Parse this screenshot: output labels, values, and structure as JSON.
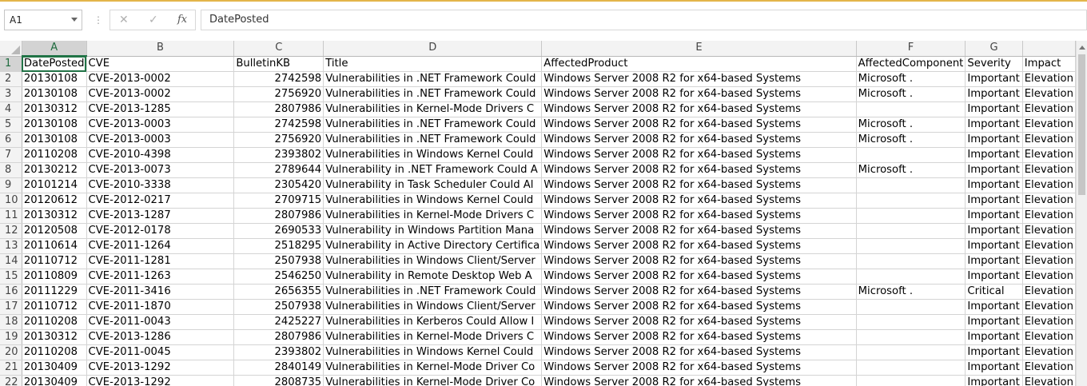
{
  "formula_bar": {
    "name_box": "A1",
    "separator": "⋮",
    "cancel_icon": "✕",
    "enter_icon": "✓",
    "fx_label": "fx",
    "content": "DatePosted"
  },
  "columns": [
    "A",
    "B",
    "C",
    "D",
    "E",
    "F",
    "G",
    ""
  ],
  "rows": [
    {
      "n": "1",
      "c": [
        "DatePosted",
        "CVE",
        "BulletinKB",
        "Title",
        "AffectedProduct",
        "AffectedComponent",
        "Severity",
        "Impact"
      ]
    },
    {
      "n": "2",
      "c": [
        "20130108",
        "CVE-2013-0002",
        "2742598",
        "Vulnerabilities in .NET Framework Could",
        "Windows Server 2008 R2 for x64-based Systems",
        "Microsoft .",
        "Important",
        "Elevation"
      ]
    },
    {
      "n": "3",
      "c": [
        "20130108",
        "CVE-2013-0002",
        "2756920",
        "Vulnerabilities in .NET Framework Could",
        "Windows Server 2008 R2 for x64-based Systems",
        "Microsoft .",
        "Important",
        "Elevation"
      ]
    },
    {
      "n": "4",
      "c": [
        "20130312",
        "CVE-2013-1285",
        "2807986",
        "Vulnerabilities in Kernel-Mode Drivers C",
        "Windows Server 2008 R2 for x64-based Systems",
        "",
        "Important",
        "Elevation"
      ]
    },
    {
      "n": "5",
      "c": [
        "20130108",
        "CVE-2013-0003",
        "2742598",
        "Vulnerabilities in .NET Framework Could",
        "Windows Server 2008 R2 for x64-based Systems",
        "Microsoft .",
        "Important",
        "Elevation"
      ]
    },
    {
      "n": "6",
      "c": [
        "20130108",
        "CVE-2013-0003",
        "2756920",
        "Vulnerabilities in .NET Framework Could",
        "Windows Server 2008 R2 for x64-based Systems",
        "Microsoft .",
        "Important",
        "Elevation"
      ]
    },
    {
      "n": "7",
      "c": [
        "20110208",
        "CVE-2010-4398",
        "2393802",
        "Vulnerabilities in Windows Kernel Could",
        "Windows Server 2008 R2 for x64-based Systems",
        "",
        "Important",
        "Elevation"
      ]
    },
    {
      "n": "8",
      "c": [
        "20130212",
        "CVE-2013-0073",
        "2789644",
        "Vulnerability in .NET Framework Could A",
        "Windows Server 2008 R2 for x64-based Systems",
        "Microsoft .",
        "Important",
        "Elevation"
      ]
    },
    {
      "n": "9",
      "c": [
        "20101214",
        "CVE-2010-3338",
        "2305420",
        "Vulnerability in Task Scheduler Could Al",
        "Windows Server 2008 R2 for x64-based Systems",
        "",
        "Important",
        "Elevation"
      ]
    },
    {
      "n": "10",
      "c": [
        "20120612",
        "CVE-2012-0217",
        "2709715",
        "Vulnerabilities in Windows Kernel Could",
        "Windows Server 2008 R2 for x64-based Systems",
        "",
        "Important",
        "Elevation"
      ]
    },
    {
      "n": "11",
      "c": [
        "20130312",
        "CVE-2013-1287",
        "2807986",
        "Vulnerabilities in Kernel-Mode Drivers C",
        "Windows Server 2008 R2 for x64-based Systems",
        "",
        "Important",
        "Elevation"
      ]
    },
    {
      "n": "12",
      "c": [
        "20120508",
        "CVE-2012-0178",
        "2690533",
        "Vulnerability in Windows Partition Mana",
        "Windows Server 2008 R2 for x64-based Systems",
        "",
        "Important",
        "Elevation"
      ]
    },
    {
      "n": "13",
      "c": [
        "20110614",
        "CVE-2011-1264",
        "2518295",
        "Vulnerability in Active Directory Certifica",
        "Windows Server 2008 R2 for x64-based Systems",
        "",
        "Important",
        "Elevation"
      ]
    },
    {
      "n": "14",
      "c": [
        "20110712",
        "CVE-2011-1281",
        "2507938",
        "Vulnerabilities in Windows Client/Server",
        "Windows Server 2008 R2 for x64-based Systems",
        "",
        "Important",
        "Elevation"
      ]
    },
    {
      "n": "15",
      "c": [
        "20110809",
        "CVE-2011-1263",
        "2546250",
        "Vulnerability in Remote Desktop Web A",
        "Windows Server 2008 R2 for x64-based Systems",
        "",
        "Important",
        "Elevation"
      ]
    },
    {
      "n": "16",
      "c": [
        "20111229",
        "CVE-2011-3416",
        "2656355",
        "Vulnerabilities in .NET Framework Could",
        "Windows Server 2008 R2 for x64-based Systems",
        "Microsoft .",
        "Critical",
        "Elevation"
      ]
    },
    {
      "n": "17",
      "c": [
        "20110712",
        "CVE-2011-1870",
        "2507938",
        "Vulnerabilities in Windows Client/Server",
        "Windows Server 2008 R2 for x64-based Systems",
        "",
        "Important",
        "Elevation"
      ]
    },
    {
      "n": "18",
      "c": [
        "20110208",
        "CVE-2011-0043",
        "2425227",
        "Vulnerabilities in Kerberos Could Allow I",
        "Windows Server 2008 R2 for x64-based Systems",
        "",
        "Important",
        "Elevation"
      ]
    },
    {
      "n": "19",
      "c": [
        "20130312",
        "CVE-2013-1286",
        "2807986",
        "Vulnerabilities in Kernel-Mode Drivers C",
        "Windows Server 2008 R2 for x64-based Systems",
        "",
        "Important",
        "Elevation"
      ]
    },
    {
      "n": "20",
      "c": [
        "20110208",
        "CVE-2011-0045",
        "2393802",
        "Vulnerabilities in Windows Kernel Could",
        "Windows Server 2008 R2 for x64-based Systems",
        "",
        "Important",
        "Elevation"
      ]
    },
    {
      "n": "21",
      "c": [
        "20130409",
        "CVE-2013-1292",
        "2840149",
        "Vulnerabilities in Kernel-Mode Driver Co",
        "Windows Server 2008 R2 for x64-based Systems",
        "",
        "Important",
        "Elevation"
      ]
    },
    {
      "n": "22",
      "c": [
        "20130409",
        "CVE-2013-1292",
        "2808735",
        "Vulnerabilities in Kernel-Mode Driver Co",
        "Windows Server 2008 R2 for x64-based Systems",
        "",
        "Important",
        "Elevation"
      ]
    }
  ]
}
